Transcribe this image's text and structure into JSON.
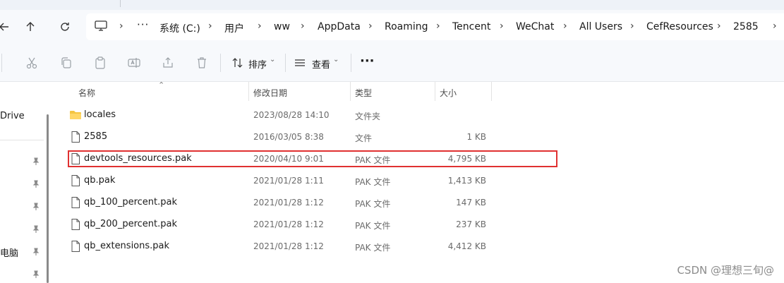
{
  "breadcrumbs": [
    "系统 (C:)",
    "用户",
    "ww",
    "AppData",
    "Roaming",
    "Tencent",
    "WeChat",
    "All Users",
    "CefResources",
    "2585"
  ],
  "nav": {
    "more_glyph": "···"
  },
  "toolbar": {
    "sort_label": "排序",
    "view_label": "查看",
    "more_glyph": "···"
  },
  "sidebar": {
    "items": [
      "Drive",
      "电脑"
    ]
  },
  "columns": {
    "name": "名称",
    "date": "修改日期",
    "type": "类型",
    "size": "大小"
  },
  "files": [
    {
      "name": "locales",
      "date": "2023/08/28 14:10",
      "type": "文件夹",
      "size": "",
      "icon": "folder-icon"
    },
    {
      "name": "2585",
      "date": "2016/03/05 8:38",
      "type": "文件",
      "size": "1 KB",
      "icon": "file-icon"
    },
    {
      "name": "devtools_resources.pak",
      "date": "2020/04/10 9:01",
      "type": "PAK 文件",
      "size": "4,795 KB",
      "icon": "file-icon"
    },
    {
      "name": "qb.pak",
      "date": "2021/01/28 1:11",
      "type": "PAK 文件",
      "size": "1,413 KB",
      "icon": "file-icon"
    },
    {
      "name": "qb_100_percent.pak",
      "date": "2021/01/28 1:12",
      "type": "PAK 文件",
      "size": "147 KB",
      "icon": "file-icon"
    },
    {
      "name": "qb_200_percent.pak",
      "date": "2021/01/28 1:12",
      "type": "PAK 文件",
      "size": "237 KB",
      "icon": "file-icon"
    },
    {
      "name": "qb_extensions.pak",
      "date": "2021/01/28 1:12",
      "type": "PAK 文件",
      "size": "4,412 KB",
      "icon": "file-icon"
    }
  ],
  "watermark": "CSDN @理想三旬@",
  "colors": {
    "highlight": "#e03131",
    "folder": "#f4c542"
  }
}
